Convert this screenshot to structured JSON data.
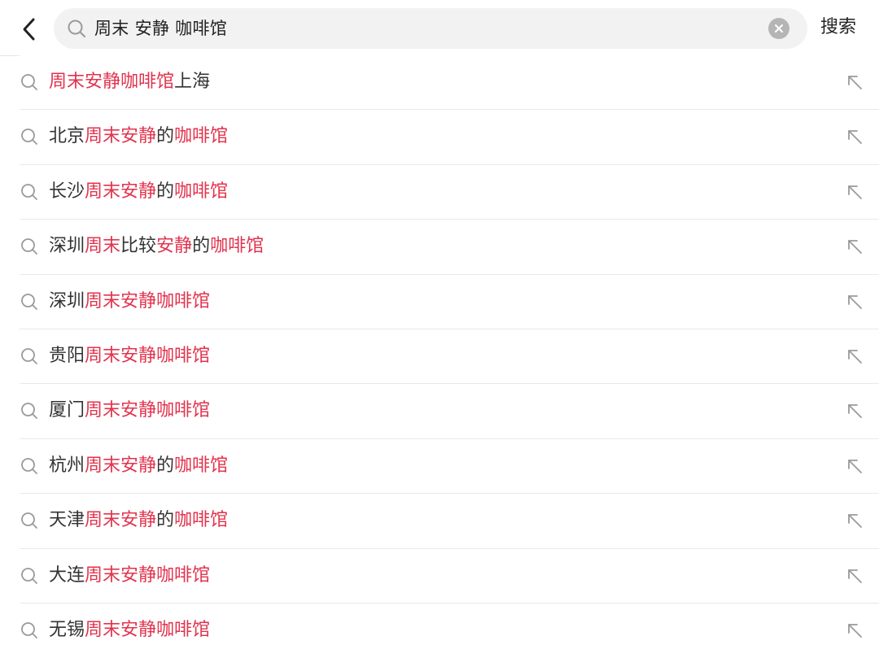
{
  "header": {
    "back_icon": "chevron-left-icon",
    "search_icon": "search-icon",
    "query": "周末 安静 咖啡馆",
    "clear_icon": "clear-circle-icon",
    "submit_label": "搜索"
  },
  "colors": {
    "highlight": "#e2334d",
    "text": "#333333",
    "icon": "#9a9a9a",
    "search_bg": "#f2f2f2"
  },
  "suggestions": [
    {
      "segments": [
        {
          "t": "周末安静咖啡馆",
          "h": true
        },
        {
          "t": "上海",
          "h": false
        }
      ]
    },
    {
      "segments": [
        {
          "t": "北京",
          "h": false
        },
        {
          "t": "周末安静",
          "h": true
        },
        {
          "t": "的",
          "h": false
        },
        {
          "t": "咖啡馆",
          "h": true
        }
      ]
    },
    {
      "segments": [
        {
          "t": "长沙",
          "h": false
        },
        {
          "t": "周末安静",
          "h": true
        },
        {
          "t": "的",
          "h": false
        },
        {
          "t": "咖啡馆",
          "h": true
        }
      ]
    },
    {
      "segments": [
        {
          "t": "深圳",
          "h": false
        },
        {
          "t": "周末",
          "h": true
        },
        {
          "t": "比较",
          "h": false
        },
        {
          "t": "安静",
          "h": true
        },
        {
          "t": "的",
          "h": false
        },
        {
          "t": "咖啡馆",
          "h": true
        }
      ]
    },
    {
      "segments": [
        {
          "t": "深圳",
          "h": false
        },
        {
          "t": "周末安静咖啡馆",
          "h": true
        }
      ]
    },
    {
      "segments": [
        {
          "t": "贵阳",
          "h": false
        },
        {
          "t": "周末安静咖啡馆",
          "h": true
        }
      ]
    },
    {
      "segments": [
        {
          "t": "厦门",
          "h": false
        },
        {
          "t": "周末安静咖啡馆",
          "h": true
        }
      ]
    },
    {
      "segments": [
        {
          "t": "杭州",
          "h": false
        },
        {
          "t": "周末安静",
          "h": true
        },
        {
          "t": "的",
          "h": false
        },
        {
          "t": "咖啡馆",
          "h": true
        }
      ]
    },
    {
      "segments": [
        {
          "t": "天津",
          "h": false
        },
        {
          "t": "周末安静",
          "h": true
        },
        {
          "t": "的",
          "h": false
        },
        {
          "t": "咖啡馆",
          "h": true
        }
      ]
    },
    {
      "segments": [
        {
          "t": "大连",
          "h": false
        },
        {
          "t": "周末安静咖啡馆",
          "h": true
        }
      ]
    },
    {
      "segments": [
        {
          "t": "无锡",
          "h": false
        },
        {
          "t": "周末安静咖啡馆",
          "h": true
        }
      ]
    }
  ],
  "row_icons": {
    "search": "search-icon",
    "fill": "arrow-up-left-icon"
  }
}
